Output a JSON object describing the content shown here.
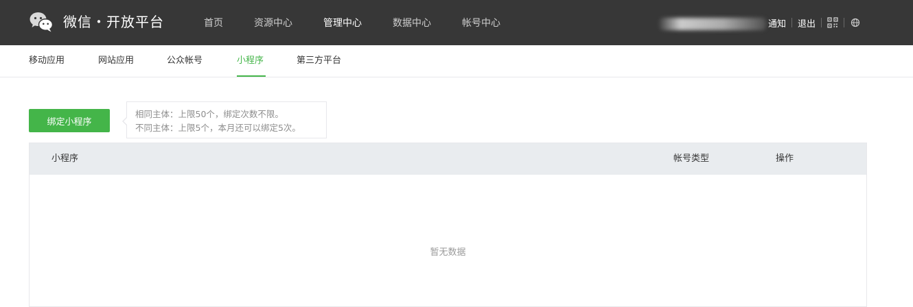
{
  "header": {
    "brand": "微信・开放平台",
    "nav": [
      {
        "label": "首页",
        "active": false
      },
      {
        "label": "资源中心",
        "active": false
      },
      {
        "label": "管理中心",
        "active": true
      },
      {
        "label": "数据中心",
        "active": false
      },
      {
        "label": "帐号中心",
        "active": false
      }
    ],
    "links": {
      "notify": "通知",
      "logout": "退出"
    },
    "icons": {
      "logo": "wechat-logo-icon",
      "qrcode": "qrcode-icon",
      "language": "globe-icon"
    }
  },
  "subnav": {
    "tabs": [
      {
        "label": "移动应用",
        "active": false
      },
      {
        "label": "网站应用",
        "active": false
      },
      {
        "label": "公众帐号",
        "active": false
      },
      {
        "label": "小程序",
        "active": true
      },
      {
        "label": "第三方平台",
        "active": false
      }
    ]
  },
  "main": {
    "bind_button": "绑定小程序",
    "tip": {
      "line1": "相同主体：上限50个，绑定次数不限。",
      "line2": "不同主体：上限5个，本月还可以绑定5次。"
    },
    "table": {
      "columns": [
        "小程序",
        "帐号类型",
        "操作"
      ],
      "rows": [],
      "empty_text": "暂无数据"
    }
  },
  "colors": {
    "topbar": "#373737",
    "accent": "#44b549",
    "header_row": "#e9ecef"
  }
}
